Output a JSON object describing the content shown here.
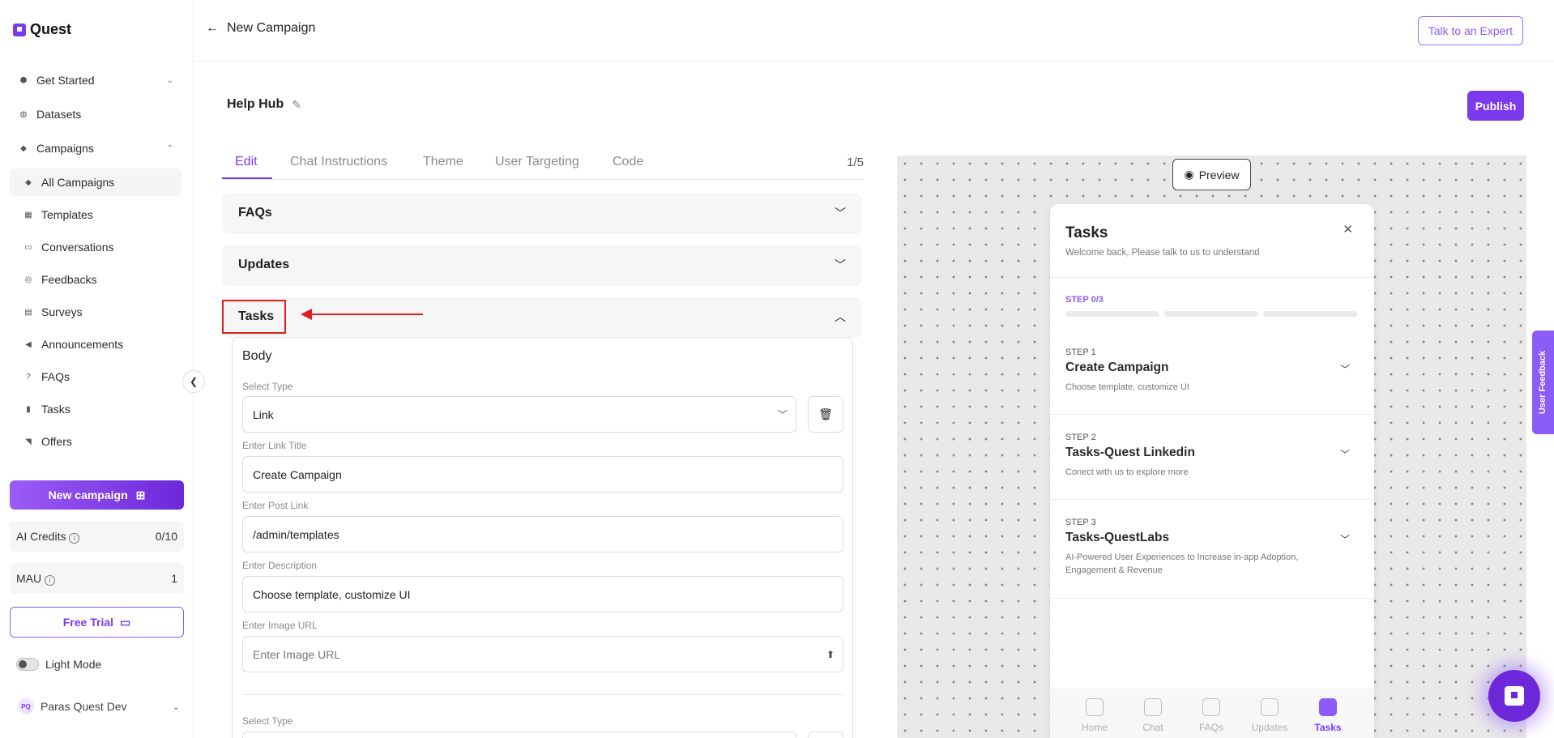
{
  "app": {
    "name": "Quest"
  },
  "sidebar": {
    "items": [
      {
        "label": "Get Started",
        "icon": "box-icon",
        "chevron": "chevron-down-icon"
      },
      {
        "label": "Datasets",
        "icon": "database-icon"
      },
      {
        "label": "Campaigns",
        "icon": "layers-icon",
        "chevron": "chevron-up-icon"
      },
      {
        "label": "All Campaigns",
        "icon": "layers-icon",
        "active": true
      },
      {
        "label": "Templates",
        "icon": "grid-icon"
      },
      {
        "label": "Conversations",
        "icon": "chat-icon"
      },
      {
        "label": "Feedbacks",
        "icon": "feedback-icon"
      },
      {
        "label": "Surveys",
        "icon": "survey-icon"
      },
      {
        "label": "Announcements",
        "icon": "megaphone-icon"
      },
      {
        "label": "FAQs",
        "icon": "question-icon"
      },
      {
        "label": "Tasks",
        "icon": "document-icon"
      },
      {
        "label": "Offers",
        "icon": "tag-icon"
      }
    ],
    "new_campaign_label": "New campaign",
    "ai_credits": {
      "label": "AI Credits",
      "value": "0/10"
    },
    "mau": {
      "label": "MAU",
      "value": "1"
    },
    "free_trial_label": "Free Trial",
    "light_mode_label": "Light Mode",
    "user": {
      "initials": "PQ",
      "name": "Paras Quest Dev"
    }
  },
  "header": {
    "back_title": "New Campaign",
    "expert_button": "Talk to an Expert"
  },
  "campaign": {
    "name": "Help Hub",
    "publish_label": "Publish"
  },
  "tabs": {
    "items": [
      "Edit",
      "Chat Instructions",
      "Theme",
      "User Targeting",
      "Code"
    ],
    "active": "Edit",
    "page_count": "1/5"
  },
  "sections": {
    "faqs": "FAQs",
    "updates": "Updates",
    "tasks": "Tasks"
  },
  "task_body": {
    "title": "Body",
    "select_type_label": "Select Type",
    "select_type_value": "Link",
    "link_title_label": "Enter Link Title",
    "link_title_value": "Create Campaign",
    "post_link_label": "Enter Post Link",
    "post_link_value": "/admin/templates",
    "description_label": "Enter Description",
    "description_value": "Choose template, customize UI",
    "image_url_label": "Enter Image URL",
    "image_url_placeholder": "Enter Image URL",
    "second_select_type_label": "Select Type"
  },
  "preview": {
    "button_label": "Preview",
    "widget": {
      "title": "Tasks",
      "subtitle": "Welcome back, Please talk to us to understand",
      "step_count": "STEP 0/3",
      "steps": [
        {
          "label": "STEP 1",
          "title": "Create Campaign",
          "description": "Choose template, customize UI"
        },
        {
          "label": "STEP 2",
          "title": "Tasks-Quest Linkedin",
          "description": "Conect with us to explore more"
        },
        {
          "label": "STEP 3",
          "title": "Tasks-QuestLabs",
          "description": "AI-Powered User Experiences to Increase in-app Adoption, Engagement & Revenue"
        }
      ],
      "nav": [
        "Home",
        "Chat",
        "FAQs",
        "Updates",
        "Tasks"
      ],
      "nav_active": "Tasks"
    },
    "feedback_tab": "User Feedback"
  },
  "colors": {
    "accent": "#7c3aed",
    "annotation": "#e11d1d",
    "preview_bg": "#e9e9e9"
  }
}
